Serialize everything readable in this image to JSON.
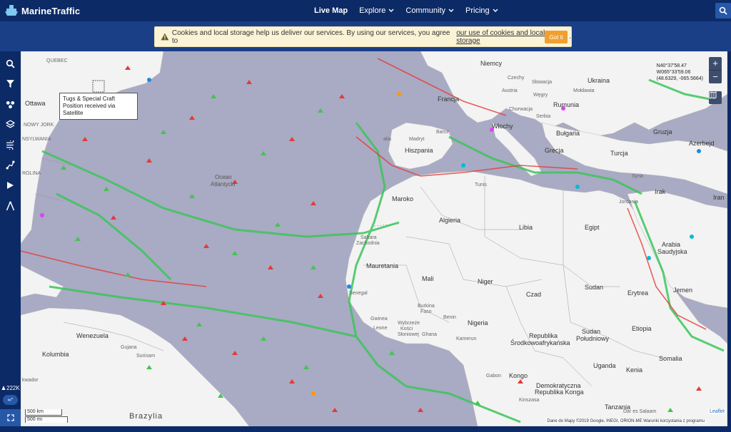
{
  "brand": {
    "name": "MarineTraffic",
    "icon": "ship-logo-icon"
  },
  "nav": {
    "items": [
      {
        "label": "Live Map",
        "active": true,
        "dropdown": false
      },
      {
        "label": "Explore",
        "active": false,
        "dropdown": true
      },
      {
        "label": "Community",
        "active": false,
        "dropdown": true
      },
      {
        "label": "Pricing",
        "active": false,
        "dropdown": true
      }
    ]
  },
  "cookie": {
    "message": "Cookies and local storage help us deliver our services. By using our services, you agree to",
    "link": "our use of cookies and local storage",
    "period": ".",
    "button": "Got it"
  },
  "sidebar": {
    "icons": [
      "search-icon",
      "filter-icon",
      "density-icon",
      "layers-icon",
      "weather-icon",
      "route-icon",
      "play-icon",
      "compass-icon"
    ],
    "vessel_count": "222K",
    "toggle_label": "∞°"
  },
  "tooltip": {
    "line1": "Tugs & Special Craft",
    "line2": "Position received via Satellite"
  },
  "coords": {
    "lat": "N40°37'58.47",
    "lon": "W065°33'59.06",
    "decimal": "(48.6329, -065.5664)"
  },
  "zoom": {
    "in": "+",
    "out": "−"
  },
  "scale": {
    "km": "500 km",
    "mi": "500 mi"
  },
  "attribution": "Dane do Mapy ©2019 Google, INEGI, ORION-ME   Warunki korzystania z programu",
  "leaflet": "Leaflet",
  "map_labels": {
    "quebec": "QUEBEC",
    "ottawa": "Ottawa",
    "new_york": "NOWY JORK",
    "pennsylvania": "NSYLWANIA",
    "carolina": "ROLINA",
    "ocean": "Ocean",
    "atlantic": "Atlantycki",
    "france": "Francja",
    "germany": "Niemcy",
    "czech": "Czechy",
    "austria": "Austria",
    "slovakia": "Słowacja",
    "ukraine": "Ukraina",
    "moldova": "Mołdawia",
    "hungary": "Węgry",
    "croatia": "Chorwacja",
    "serbia": "Serbia",
    "romania": "Rumunia",
    "bulgaria": "Bułgaria",
    "italy": "Włochy",
    "greece": "Grecja",
    "turkey": "Turcja",
    "georgia": "Gruzja",
    "azerbaijan": "Azerbejd",
    "syria": "Syria",
    "iraq": "Irak",
    "iran": "Iran",
    "jordan": "Jordania",
    "madrid": "Madryt",
    "spain": "Hiszpania",
    "barcelona": "Barce",
    "portugal": "alia",
    "morocco": "Maroko",
    "algeria": "Algieria",
    "tunisia": "Tunezja",
    "libya": "Libia",
    "egypt": "Egipt",
    "saudi1": "Arabia",
    "saudi2": "Saudyjska",
    "w_sahara1": "Sahara",
    "w_sahara2": "Zachodnia",
    "mauritania": "Mauretania",
    "mali": "Mali",
    "niger": "Niger",
    "chad": "Czad",
    "sudan": "Sudan",
    "eritrea": "Erytrea",
    "yemen": "Jemen",
    "senegal": "Senegal",
    "guinea": "Gwinea",
    "sierra": "Leone",
    "cote1": "Wybrzeże",
    "cote2": "Kości",
    "cote3": "Słoniowej",
    "ghana": "Ghana",
    "burkina1": "Burkina",
    "burkina2": "Faso",
    "benin": "Benin",
    "nigeria": "Nigeria",
    "car1": "Republika",
    "car2": "Środkowoafrykańska",
    "s_sudan1": "Sudan",
    "s_sudan2": "Południowy",
    "ethiopia": "Etiopia",
    "somalia": "Somalia",
    "kenya": "Kenia",
    "uganda": "Uganda",
    "gabon": "Gabon",
    "congo": "Kongo",
    "drc1": "Demokratyczna",
    "drc2": "Republika Konga",
    "kinshasa": "Kinszasa",
    "tanzania": "Tanzania",
    "dar": "Dar es Salaam",
    "venezuela": "Wenezuela",
    "colombia": "Kolumbia",
    "guyana": "Gujana",
    "suriname": "Surinam",
    "ecuador": "kwador",
    "brazil": "Brazylia",
    "cameroon": "Kamerun",
    "sudan_sm": "Sudan",
    "sardinia": "Sardynia",
    "tunis": "Tunis"
  }
}
